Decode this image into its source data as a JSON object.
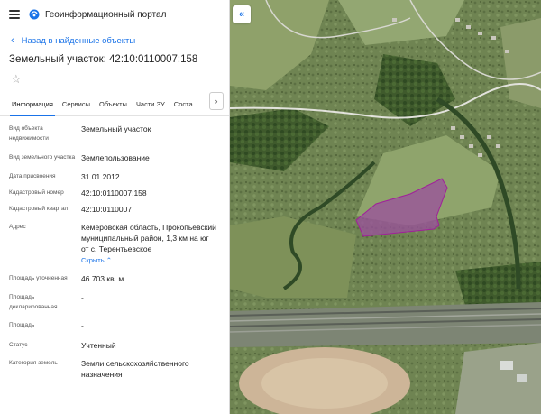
{
  "app": {
    "title": "Геоинформационный портал"
  },
  "nav": {
    "back_label": "Назад в найденные объекты"
  },
  "object": {
    "title": "Земельный участок: 42:10:0110007:158"
  },
  "tabs": [
    {
      "label": "Информация",
      "active": true
    },
    {
      "label": "Сервисы"
    },
    {
      "label": "Объекты"
    },
    {
      "label": "Части ЗУ"
    },
    {
      "label": "Соста"
    }
  ],
  "fields": [
    {
      "label": "Вид объекта недвижимости",
      "value": "Земельный участок"
    },
    {
      "label": "Вид земельного участка",
      "value": "Землепользование"
    },
    {
      "label": "Дата присвоения",
      "value": "31.01.2012"
    },
    {
      "label": "Кадастровый номер",
      "value": "42:10:0110007:158"
    },
    {
      "label": "Кадастровый квартал",
      "value": "42:10:0110007"
    },
    {
      "label": "Адрес",
      "value": "Кемеровская область, Прокопьевский муниципальный район, 1,3 км на юг от с. Терентьевское",
      "action": "Скрыть"
    },
    {
      "label": "Площадь уточненная",
      "value": "46 703 кв. м"
    },
    {
      "label": "Площадь декларированная",
      "value": "-"
    },
    {
      "label": "Площадь",
      "value": "-"
    },
    {
      "label": "Статус",
      "value": "Учтенный"
    },
    {
      "label": "Категория земель",
      "value": "Земли сельскохозяйственного назначения"
    }
  ],
  "colors": {
    "accent": "#1a73e8",
    "parcel_fill": "#9b4f9e",
    "parcel_stroke": "#a0209a"
  },
  "icons": {
    "menu": "hamburger-icon",
    "logo": "portal-logo-icon",
    "back": "chevron-left-icon",
    "favorite": "star-icon",
    "tabs_next": "chevron-right-icon",
    "collapse_panel": "double-chevron-left-icon"
  }
}
